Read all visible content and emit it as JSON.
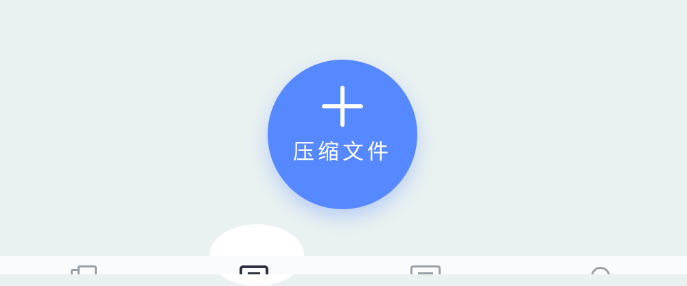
{
  "main": {
    "compress_button": {
      "label": "压缩文件",
      "icon": "plus-icon",
      "color": "#5688ff"
    }
  },
  "tab_bar": {
    "items": [
      {
        "icon": "files-icon",
        "selected": false
      },
      {
        "icon": "zip-icon",
        "selected": true
      },
      {
        "icon": "preview-icon",
        "selected": false
      },
      {
        "icon": "profile-icon",
        "selected": false
      }
    ]
  }
}
